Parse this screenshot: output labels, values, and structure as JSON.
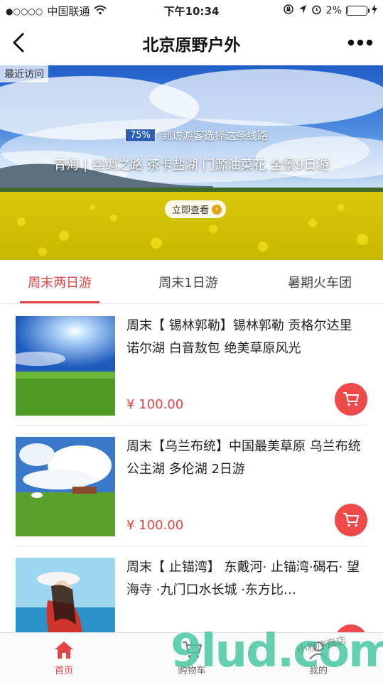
{
  "status_bar": {
    "signal_dots": "●○○○○",
    "carrier": "中国联通",
    "wifi_icon": "wifi-icon",
    "time": "下午10:34",
    "battery_percent": "2%",
    "battery_level": 0.02
  },
  "nav": {
    "back_icon": "chevron-left-icon",
    "title": "北京原野户外",
    "more_icon": "more-dots-icon"
  },
  "banner": {
    "tag": "最近访问",
    "stat_percent": "75%",
    "stat_text": "到访游客选择这条线路",
    "title": "青海 | 丝绸之路 茶卡盐湖 门源油菜花 全景9日游",
    "button_label": "立即查看"
  },
  "tabs": [
    {
      "label": "周末两日游",
      "active": true
    },
    {
      "label": "周末1日游",
      "active": false
    },
    {
      "label": "暑期火车团",
      "active": false
    }
  ],
  "items": [
    {
      "title": "周末【 锡林郭勒】锡林郭勒 贡格尔达里诺尔湖 白音敖包 绝美草原风光",
      "price": "¥ 100.00"
    },
    {
      "title": "周末【乌兰布统】中国最美草原 乌兰布统 公主湖 多伦湖 2日游",
      "price": "¥ 100.00"
    },
    {
      "title": "周末【 止锚湾】 东戴河· 止锚湾·碣石· 望海寺 ·九门口水长城 ·东方比…",
      "price": ""
    }
  ],
  "tabbar": [
    {
      "label": "首页",
      "icon": "home-icon",
      "active": true
    },
    {
      "label": "购物车",
      "icon": "cart-icon",
      "active": false
    },
    {
      "label": "我的",
      "icon": "user-icon",
      "active": false
    }
  ],
  "watermark": {
    "text": "9lud.com",
    "sub": "小程序商店"
  },
  "colors": {
    "accent": "#e64343",
    "cart_button": "#ef4a4a"
  }
}
